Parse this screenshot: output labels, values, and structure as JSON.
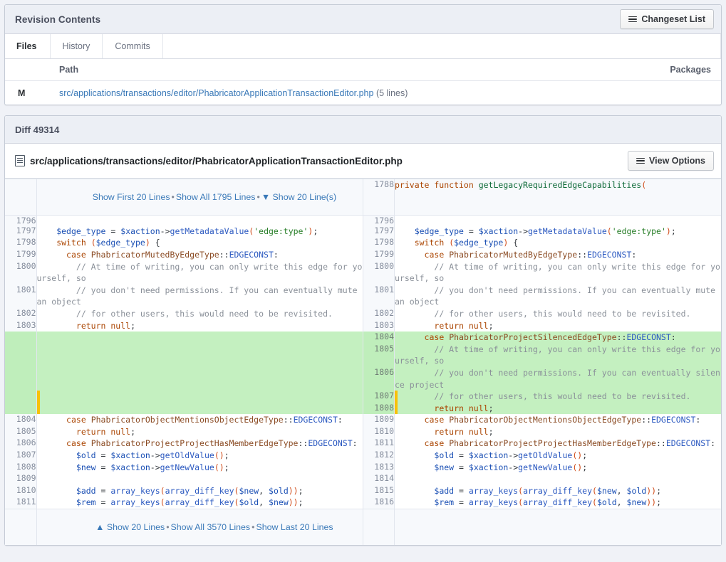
{
  "revision_contents": {
    "title": "Revision Contents",
    "changeset_button": "Changeset List",
    "tabs": [
      {
        "label": "Files",
        "active": true
      },
      {
        "label": "History",
        "active": false
      },
      {
        "label": "Commits",
        "active": false
      }
    ],
    "table": {
      "headers": {
        "path": "Path",
        "packages": "Packages"
      },
      "rows": [
        {
          "status": "M",
          "path": "src/applications/transactions/editor/PhabricatorApplicationTransactionEditor.php",
          "meta": "(5 lines)",
          "packages": ""
        }
      ]
    }
  },
  "diff": {
    "title": "Diff 49314",
    "file_path": "src/applications/transactions/editor/PhabricatorApplicationTransactionEditor.php",
    "view_options_button": "View Options",
    "top_context": {
      "show_first": "Show First 20 Lines",
      "show_all": "Show All 1795 Lines",
      "show_n": "Show 20 Line(s)",
      "down_arrow": "▼",
      "sep": "•"
    },
    "bottom_context": {
      "up_arrow": "▲",
      "show_n": "Show 20 Lines",
      "show_all": "Show All 3570 Lines",
      "show_last": "Show Last 20 Lines",
      "sep": "•"
    },
    "context_line": {
      "right_no": "1788",
      "text": "private function getLegacyRequiredEdgeCapabilities("
    },
    "left_lines": [
      {
        "no": "1796",
        "text": ""
      },
      {
        "no": "1797",
        "text": "    $edge_type = $xaction->getMetadataValue('edge:type');"
      },
      {
        "no": "1798",
        "text": "    switch ($edge_type) {"
      },
      {
        "no": "1799",
        "text": "      case PhabricatorMutedByEdgeType::EDGECONST:"
      },
      {
        "no": "1800",
        "text": "        // At time of writing, you can only write this edge for yourself, so"
      },
      {
        "no": "1801",
        "text": "        // you don't need permissions. If you can eventually mute an object"
      },
      {
        "no": "1802",
        "text": "        // for other users, this would need to be revisited."
      },
      {
        "no": "1803",
        "text": "        return null;"
      },
      {
        "no": "",
        "text": ""
      },
      {
        "no": "",
        "text": ""
      },
      {
        "no": "",
        "text": ""
      },
      {
        "no": "",
        "text": ""
      },
      {
        "no": "",
        "text": ""
      },
      {
        "no": "1804",
        "text": "      case PhabricatorObjectMentionsObjectEdgeType::EDGECONST:"
      },
      {
        "no": "1805",
        "text": "        return null;"
      },
      {
        "no": "1806",
        "text": "      case PhabricatorProjectProjectHasMemberEdgeType::EDGECONST:"
      },
      {
        "no": "1807",
        "text": "        $old = $xaction->getOldValue();"
      },
      {
        "no": "1808",
        "text": "        $new = $xaction->getNewValue();"
      },
      {
        "no": "1809",
        "text": ""
      },
      {
        "no": "1810",
        "text": "        $add = array_keys(array_diff_key($new, $old));"
      },
      {
        "no": "1811",
        "text": "        $rem = array_keys(array_diff_key($old, $new));"
      }
    ],
    "right_lines": [
      {
        "no": "1796",
        "text": "",
        "state": "context"
      },
      {
        "no": "1797",
        "text": "    $edge_type = $xaction->getMetadataValue('edge:type');",
        "state": "context"
      },
      {
        "no": "1798",
        "text": "    switch ($edge_type) {",
        "state": "context"
      },
      {
        "no": "1799",
        "text": "      case PhabricatorMutedByEdgeType::EDGECONST:",
        "state": "context"
      },
      {
        "no": "1800",
        "text": "        // At time of writing, you can only write this edge for yourself, so",
        "state": "context"
      },
      {
        "no": "1801",
        "text": "        // you don't need permissions. If you can eventually mute an object",
        "state": "context"
      },
      {
        "no": "1802",
        "text": "        // for other users, this would need to be revisited.",
        "state": "context"
      },
      {
        "no": "1803",
        "text": "        return null;",
        "state": "context"
      },
      {
        "no": "1804",
        "text": "      case PhabricatorProjectSilencedEdgeType::EDGECONST:",
        "state": "new"
      },
      {
        "no": "1805",
        "text": "        // At time of writing, you can only write this edge for yourself, so",
        "state": "new"
      },
      {
        "no": "1806",
        "text": "        // you don't need permissions. If you can eventually silence project",
        "state": "new"
      },
      {
        "no": "1807",
        "text": "        // for other users, this would need to be revisited.",
        "state": "new-mark"
      },
      {
        "no": "1808",
        "text": "        return null;",
        "state": "new-mark"
      },
      {
        "no": "1809",
        "text": "      case PhabricatorObjectMentionsObjectEdgeType::EDGECONST:",
        "state": "context"
      },
      {
        "no": "1810",
        "text": "        return null;",
        "state": "context"
      },
      {
        "no": "1811",
        "text": "      case PhabricatorProjectProjectHasMemberEdgeType::EDGECONST:",
        "state": "context"
      },
      {
        "no": "1812",
        "text": "        $old = $xaction->getOldValue();",
        "state": "context"
      },
      {
        "no": "1813",
        "text": "        $new = $xaction->getNewValue();",
        "state": "context"
      },
      {
        "no": "1814",
        "text": "",
        "state": "context"
      },
      {
        "no": "1815",
        "text": "        $add = array_keys(array_diff_key($new, $old));",
        "state": "context"
      },
      {
        "no": "1816",
        "text": "        $rem = array_keys(array_diff_key($old, $new));",
        "state": "context"
      }
    ]
  },
  "colors": {
    "accent_link": "#3a79b8",
    "added_bg": "#c4f0c0",
    "mark_bar": "#f7c10b",
    "panel_header_bg": "#eceff5",
    "gutter_bg": "#f7f9fc"
  }
}
